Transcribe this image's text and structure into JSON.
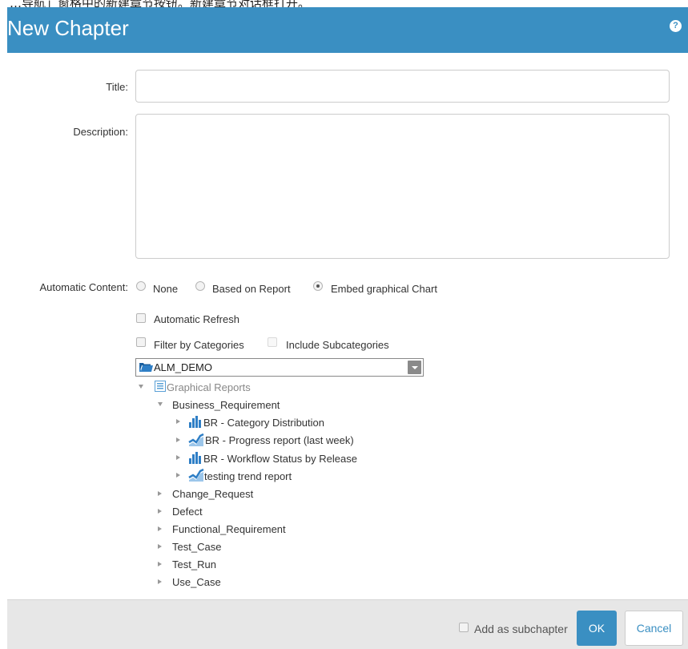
{
  "top_caption": "…导航」窗格中的新建章节按钮。新建章节对话框打开。",
  "dialog": {
    "title": "New Chapter",
    "help_icon": "?"
  },
  "form": {
    "title_label": "Title:",
    "title_value": "",
    "description_label": "Description:",
    "description_value": "",
    "automatic_content_label": "Automatic Content:",
    "automatic_content_options": [
      {
        "label": "None",
        "checked": false
      },
      {
        "label": "Based on Report",
        "checked": false
      },
      {
        "label": "Embed graphical Chart",
        "checked": true
      }
    ],
    "automatic_refresh_label": "Automatic Refresh",
    "automatic_refresh_checked": false,
    "filter_by_categories_label": "Filter by Categories",
    "filter_by_categories_checked": false,
    "include_subcategories_label": "Include Subcategories",
    "include_subcategories_checked": false,
    "project_selected": "ALM_DEMO"
  },
  "tree": {
    "root": {
      "label": "Graphical Reports",
      "icon": "report-list-icon",
      "expanded": true
    },
    "categories": [
      {
        "label": "Business_Requirement",
        "expanded": true,
        "children": [
          {
            "label": "BR - Category Distribution",
            "icon": "bar-chart-icon"
          },
          {
            "label": "BR - Progress report (last week)",
            "icon": "trend-chart-icon"
          },
          {
            "label": "BR - Workflow Status by Release",
            "icon": "bar-chart-icon"
          },
          {
            "label": "testing trend report",
            "icon": "trend-chart-icon"
          }
        ]
      },
      {
        "label": "Change_Request",
        "expanded": false
      },
      {
        "label": "Defect",
        "expanded": false
      },
      {
        "label": "Functional_Requirement",
        "expanded": false
      },
      {
        "label": "Test_Case",
        "expanded": false
      },
      {
        "label": "Test_Run",
        "expanded": false
      },
      {
        "label": "Use_Case",
        "expanded": false
      }
    ]
  },
  "footer": {
    "add_as_subchapter_label": "Add as subchapter",
    "ok_label": "OK",
    "cancel_label": "Cancel"
  },
  "colors": {
    "header": "#3a8fc2",
    "footer": "#e7e7e7",
    "chart_icon": "#2f7fc6"
  }
}
